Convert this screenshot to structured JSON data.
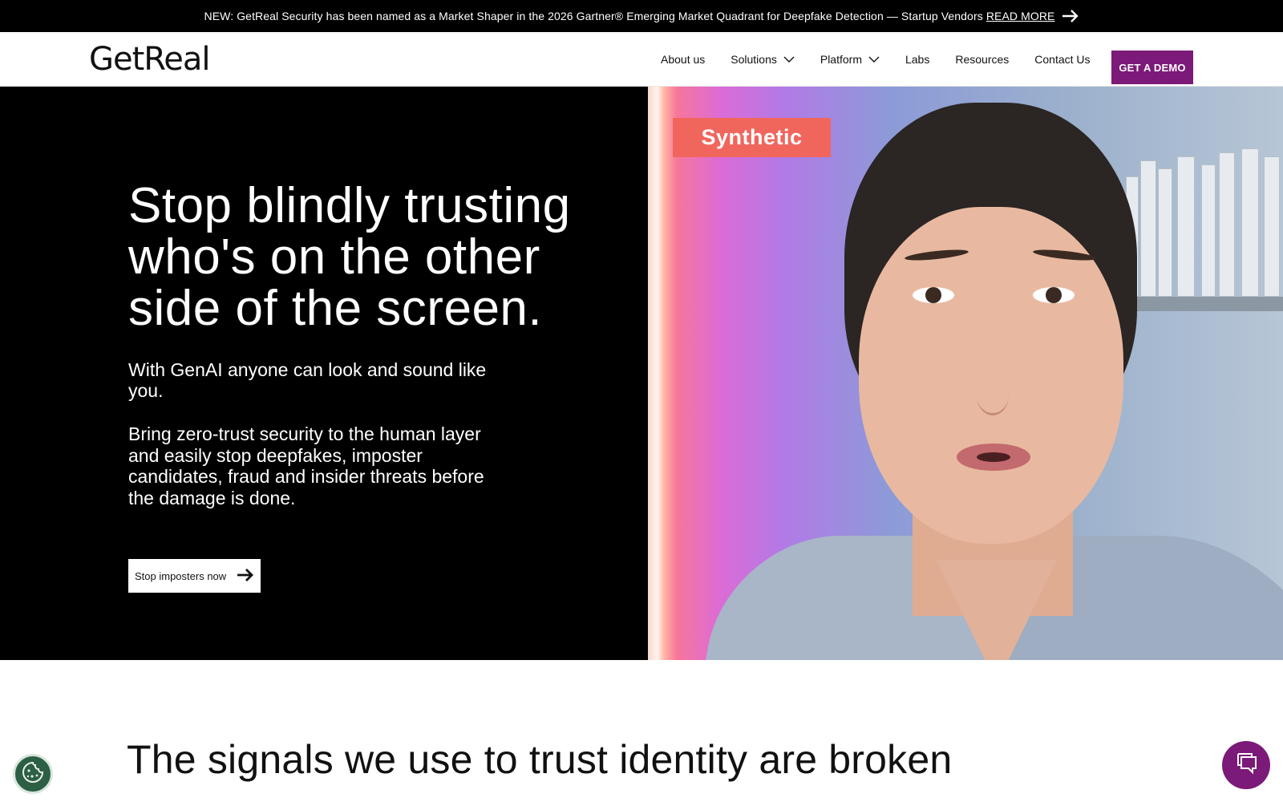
{
  "announcement": {
    "text": "NEW: GetReal Security has been named as a Market Shaper in the 2026 Gartner® Emerging Market Quadrant for Deepfake Detection — Startup Vendors",
    "link_label": "READ MORE"
  },
  "header": {
    "logo": "GetReal",
    "nav": [
      {
        "label": "About us",
        "has_dropdown": false
      },
      {
        "label": "Solutions",
        "has_dropdown": true
      },
      {
        "label": "Platform",
        "has_dropdown": true
      },
      {
        "label": "Labs",
        "has_dropdown": false
      },
      {
        "label": "Resources",
        "has_dropdown": false
      },
      {
        "label": "Contact Us",
        "has_dropdown": false
      }
    ],
    "cta_label": "GET A DEMO",
    "cta_color": "#7b1a78"
  },
  "hero": {
    "title": "Stop blindly trusting who's on the other side of the screen.",
    "subtitle": "With GenAI anyone can look and sound like you.",
    "body": "Bring zero-trust security to the human layer and easily stop deepfakes, imposter candidates, fraud and insider threats before the damage is done.",
    "cta_label": "Stop imposters now",
    "tag_label": "Synthetic",
    "tag_color": "#f0665d"
  },
  "section2": {
    "title": "The signals we use to trust identity are broken"
  },
  "widgets": {
    "cookie_icon": "cookie-icon",
    "chat_icon": "chat-icon",
    "chat_color": "#7b1a78"
  }
}
